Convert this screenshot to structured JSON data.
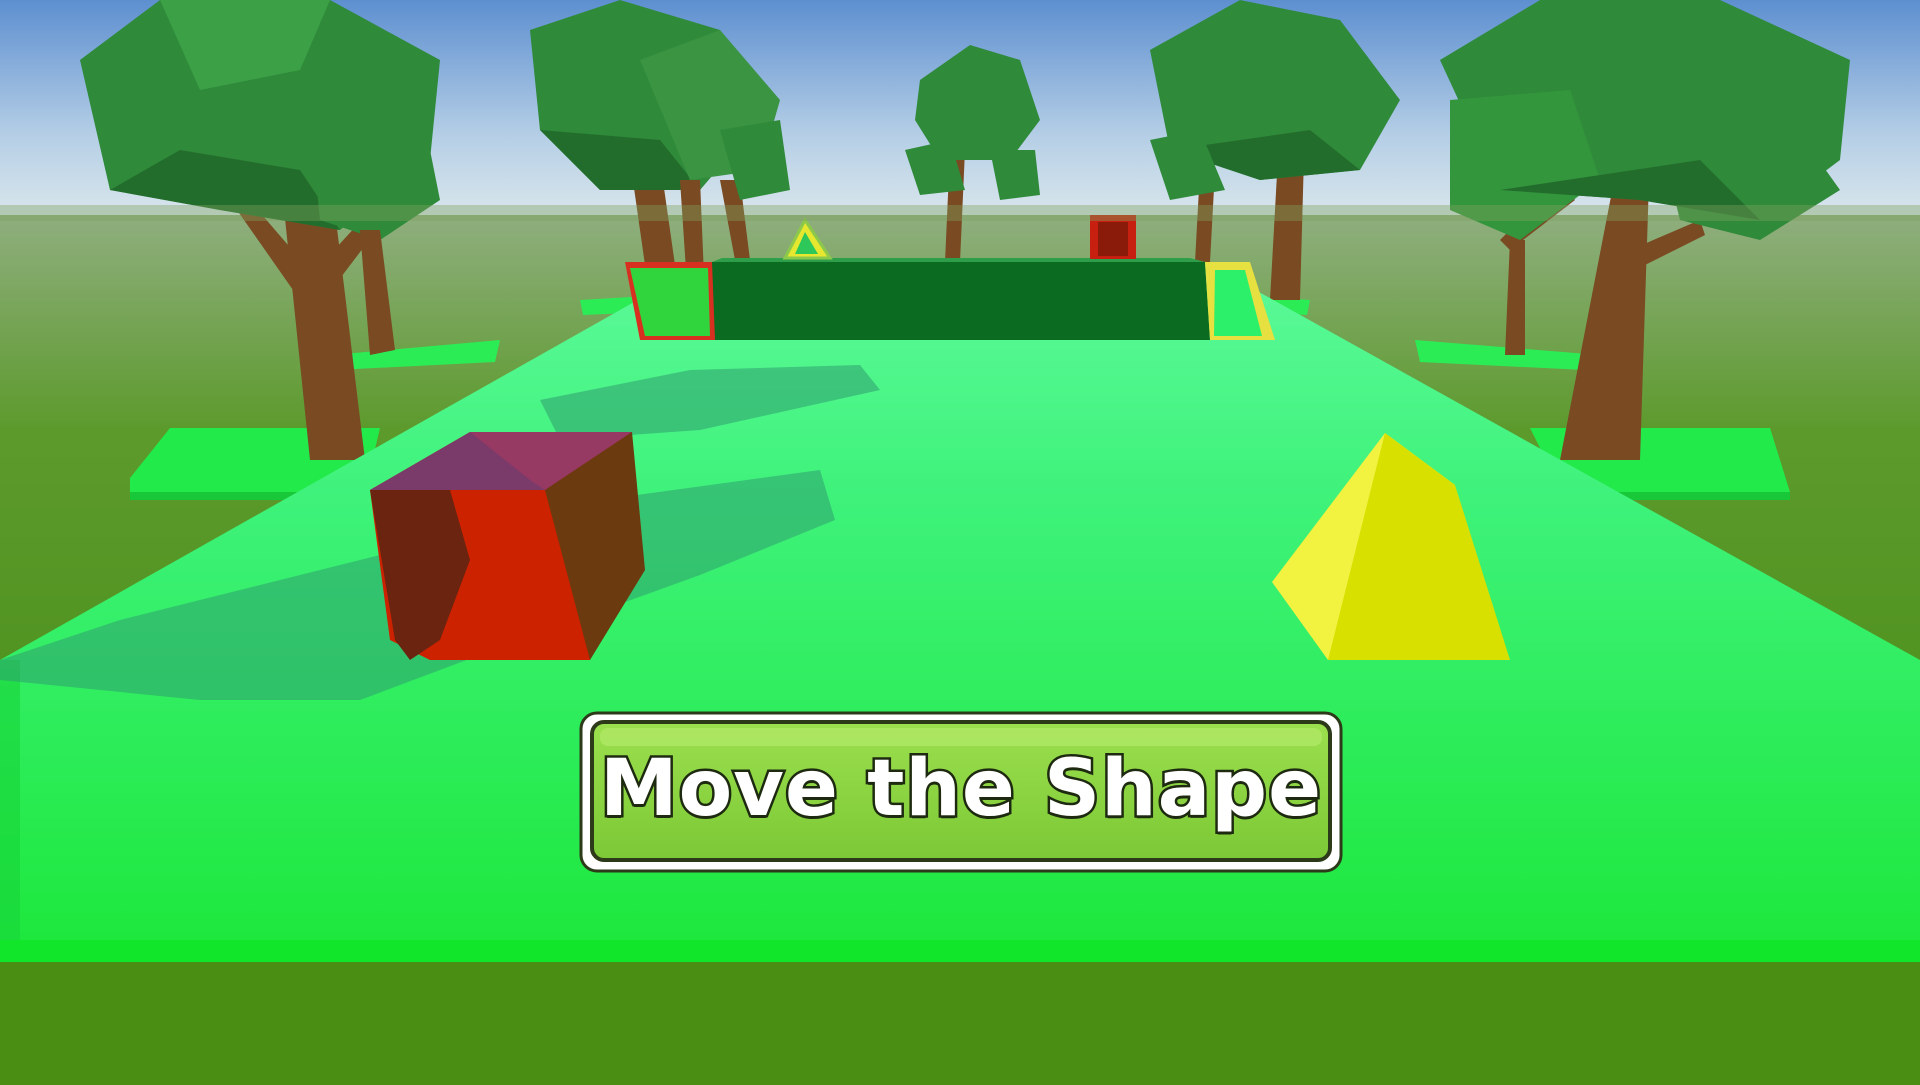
{
  "hud": {
    "action_button_label": "Move the Shape"
  },
  "scene": {
    "player_shapes": [
      "red-cube",
      "yellow-triangular-prism"
    ],
    "distant_gates": [
      "red-square-gate",
      "yellow-triangle-gate"
    ],
    "palette": {
      "sky_top": "#5d8fd0",
      "sky_horizon": "#e6eff4",
      "ground_far": "#4a8f14",
      "track": "#1ee840",
      "red_shape": "#cc2200",
      "yellow_shape": "#e6f030",
      "button_fill": "#86d43a",
      "button_border": "#2c3a1a"
    }
  }
}
